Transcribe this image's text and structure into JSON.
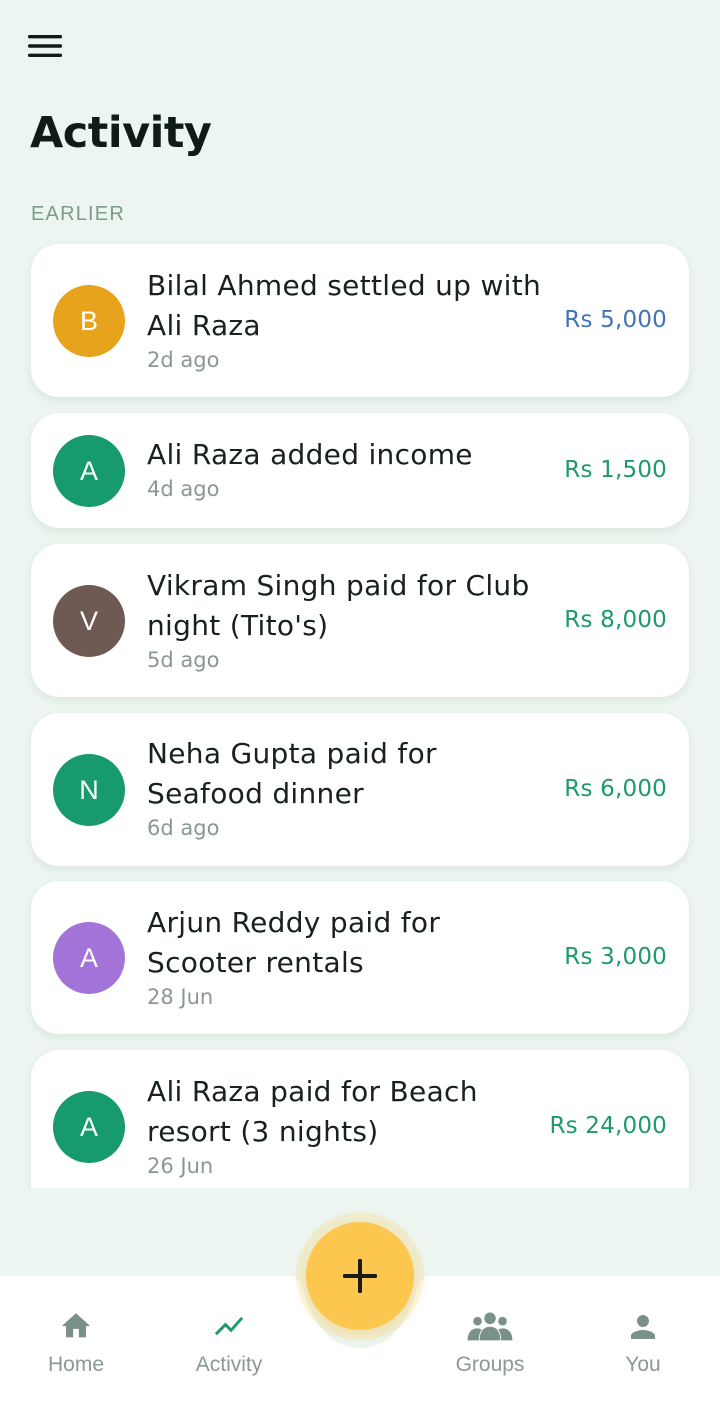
{
  "header": {
    "menu_icon": "hamburger-menu-icon",
    "title": "Activity"
  },
  "section": {
    "label": "EARLIER"
  },
  "activities": [
    {
      "initial": "B",
      "avatar_color": "#e8a31c",
      "title_line1": "Bilal Ahmed settled up with",
      "title_line2": "Ali Raza",
      "time": "2d ago",
      "amount": "Rs 5,000",
      "amount_color": "#4174b4"
    },
    {
      "initial": "A",
      "avatar_color": "#179a6c",
      "title_line1": "Ali Raza added income",
      "title_line2": "",
      "time": "4d ago",
      "amount": "Rs 1,500",
      "amount_color": "#1e9a6a"
    },
    {
      "initial": "V",
      "avatar_color": "#6e5a52",
      "title_line1": "Vikram Singh paid for Club",
      "title_line2": "night (Tito's)",
      "time": "5d ago",
      "amount": "Rs 8,000",
      "amount_color": "#1e9a6a"
    },
    {
      "initial": "N",
      "avatar_color": "#179a6c",
      "title_line1": "Neha Gupta paid for",
      "title_line2": "Seafood dinner",
      "time": "6d ago",
      "amount": "Rs 6,000",
      "amount_color": "#1e9a6a"
    },
    {
      "initial": "A",
      "avatar_color": "#a374d8",
      "title_line1": "Arjun Reddy paid for",
      "title_line2": "Scooter rentals",
      "time": "28 Jun",
      "amount": "Rs 3,000",
      "amount_color": "#1e9a6a"
    },
    {
      "initial": "A",
      "avatar_color": "#179a6c",
      "title_line1": "Ali Raza paid for Beach",
      "title_line2": "resort (3 nights)",
      "time": "26 Jun",
      "amount": "Rs 24,000",
      "amount_color": "#1e9a6a"
    }
  ],
  "fab": {
    "icon": "plus-icon",
    "color": "#fcc64f"
  },
  "nav": {
    "active": "activity",
    "active_color": "#1e9a6a",
    "inactive_color": "#8a9a92",
    "items": [
      {
        "id": "home",
        "label": "Home",
        "icon": "home-icon"
      },
      {
        "id": "activity",
        "label": "Activity",
        "icon": "activity-trend-icon"
      },
      {
        "id": "groups",
        "label": "Groups",
        "icon": "groups-icon"
      },
      {
        "id": "you",
        "label": "You",
        "icon": "person-icon"
      }
    ]
  }
}
